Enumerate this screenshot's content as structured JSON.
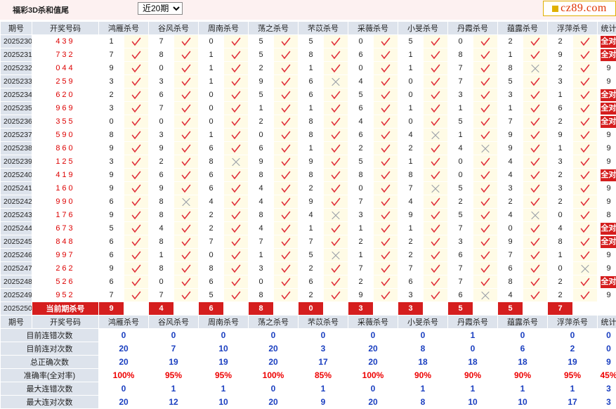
{
  "header": {
    "title": "福彩3D杀和值尾",
    "period_selected": "近20期",
    "period_options": [
      "近20期"
    ],
    "logo_text": "cz89.com"
  },
  "table": {
    "header_period": "期号",
    "header_draw": "开奖号码",
    "header_stat": "统计",
    "experts": [
      "鸿雁杀号",
      "谷风杀号",
      "周南杀号",
      "荡之杀号",
      "芣苡杀号",
      "采薇杀号",
      "小旻杀号",
      "丹霞杀号",
      "蕴露杀号",
      "浮萍杀号"
    ],
    "all_correct_label": "全对",
    "rows": [
      {
        "period": "2025230",
        "draw": "439",
        "kills": [
          "1",
          "7",
          "0",
          "5",
          "5",
          "0",
          "5",
          "0",
          "2",
          "2"
        ],
        "results": [
          1,
          1,
          1,
          1,
          1,
          1,
          1,
          1,
          1,
          1
        ],
        "stat": "全对"
      },
      {
        "period": "2025231",
        "draw": "732",
        "kills": [
          "7",
          "8",
          "1",
          "5",
          "8",
          "6",
          "1",
          "8",
          "1",
          "9"
        ],
        "results": [
          1,
          1,
          1,
          1,
          1,
          1,
          1,
          1,
          1,
          1
        ],
        "stat": "全对"
      },
      {
        "period": "2025232",
        "draw": "044",
        "kills": [
          "9",
          "0",
          "1",
          "2",
          "1",
          "0",
          "1",
          "7",
          "8",
          "2"
        ],
        "results": [
          1,
          1,
          1,
          1,
          1,
          1,
          1,
          1,
          0,
          1
        ],
        "stat": "9"
      },
      {
        "period": "2025233",
        "draw": "259",
        "kills": [
          "3",
          "3",
          "1",
          "9",
          "6",
          "4",
          "0",
          "7",
          "5",
          "3"
        ],
        "results": [
          1,
          1,
          1,
          1,
          0,
          1,
          1,
          1,
          1,
          1
        ],
        "stat": "9"
      },
      {
        "period": "2025234",
        "draw": "620",
        "kills": [
          "2",
          "6",
          "0",
          "5",
          "6",
          "5",
          "0",
          "3",
          "3",
          "1"
        ],
        "results": [
          1,
          1,
          1,
          1,
          1,
          1,
          1,
          1,
          1,
          1
        ],
        "stat": "全对"
      },
      {
        "period": "2025235",
        "draw": "969",
        "kills": [
          "3",
          "7",
          "0",
          "1",
          "1",
          "6",
          "1",
          "1",
          "1",
          "6"
        ],
        "results": [
          1,
          1,
          1,
          1,
          1,
          1,
          1,
          1,
          1,
          1
        ],
        "stat": "全对"
      },
      {
        "period": "2025236",
        "draw": "355",
        "kills": [
          "0",
          "0",
          "0",
          "2",
          "8",
          "4",
          "0",
          "5",
          "7",
          "2"
        ],
        "results": [
          1,
          1,
          1,
          1,
          1,
          1,
          1,
          1,
          1,
          1
        ],
        "stat": "全对"
      },
      {
        "period": "2025237",
        "draw": "590",
        "kills": [
          "8",
          "3",
          "1",
          "0",
          "8",
          "6",
          "4",
          "1",
          "9",
          "9"
        ],
        "results": [
          1,
          1,
          1,
          1,
          1,
          1,
          0,
          1,
          1,
          1
        ],
        "stat": "9"
      },
      {
        "period": "2025238",
        "draw": "860",
        "kills": [
          "9",
          "9",
          "6",
          "6",
          "1",
          "2",
          "2",
          "4",
          "9",
          "1"
        ],
        "results": [
          1,
          1,
          1,
          1,
          1,
          1,
          1,
          0,
          1,
          1
        ],
        "stat": "9"
      },
      {
        "period": "2025239",
        "draw": "125",
        "kills": [
          "3",
          "2",
          "8",
          "9",
          "9",
          "5",
          "1",
          "0",
          "4",
          "3"
        ],
        "results": [
          1,
          1,
          0,
          1,
          1,
          1,
          1,
          1,
          1,
          1
        ],
        "stat": "9"
      },
      {
        "period": "2025240",
        "draw": "419",
        "kills": [
          "9",
          "6",
          "6",
          "8",
          "8",
          "8",
          "8",
          "0",
          "4",
          "2"
        ],
        "results": [
          1,
          1,
          1,
          1,
          1,
          1,
          1,
          1,
          1,
          1
        ],
        "stat": "全对"
      },
      {
        "period": "2025241",
        "draw": "160",
        "kills": [
          "9",
          "9",
          "6",
          "4",
          "2",
          "0",
          "7",
          "5",
          "3",
          "3"
        ],
        "results": [
          1,
          1,
          1,
          1,
          1,
          1,
          0,
          1,
          1,
          1
        ],
        "stat": "9"
      },
      {
        "period": "2025242",
        "draw": "990",
        "kills": [
          "6",
          "8",
          "4",
          "4",
          "9",
          "7",
          "4",
          "2",
          "2",
          "2"
        ],
        "results": [
          1,
          0,
          1,
          1,
          1,
          1,
          1,
          1,
          1,
          1
        ],
        "stat": "9"
      },
      {
        "period": "2025243",
        "draw": "176",
        "kills": [
          "9",
          "8",
          "2",
          "8",
          "4",
          "3",
          "9",
          "5",
          "4",
          "0"
        ],
        "results": [
          1,
          1,
          1,
          1,
          0,
          1,
          1,
          1,
          0,
          1
        ],
        "stat": "8"
      },
      {
        "period": "2025244",
        "draw": "673",
        "kills": [
          "5",
          "4",
          "2",
          "4",
          "1",
          "1",
          "1",
          "7",
          "0",
          "4"
        ],
        "results": [
          1,
          1,
          1,
          1,
          1,
          1,
          1,
          1,
          1,
          1
        ],
        "stat": "全对"
      },
      {
        "period": "2025245",
        "draw": "848",
        "kills": [
          "6",
          "8",
          "7",
          "7",
          "7",
          "2",
          "2",
          "3",
          "9",
          "8"
        ],
        "results": [
          1,
          1,
          1,
          1,
          1,
          1,
          1,
          1,
          1,
          1
        ],
        "stat": "全对"
      },
      {
        "period": "2025246",
        "draw": "997",
        "kills": [
          "6",
          "1",
          "0",
          "1",
          "5",
          "1",
          "2",
          "6",
          "7",
          "1"
        ],
        "results": [
          1,
          1,
          1,
          1,
          0,
          1,
          1,
          1,
          1,
          1
        ],
        "stat": "9"
      },
      {
        "period": "2025247",
        "draw": "262",
        "kills": [
          "9",
          "8",
          "8",
          "3",
          "2",
          "7",
          "7",
          "7",
          "6",
          "0"
        ],
        "results": [
          1,
          1,
          1,
          1,
          1,
          1,
          1,
          1,
          1,
          0
        ],
        "stat": "9"
      },
      {
        "period": "2025248",
        "draw": "526",
        "kills": [
          "6",
          "0",
          "6",
          "0",
          "6",
          "2",
          "6",
          "7",
          "8",
          "2"
        ],
        "results": [
          1,
          1,
          1,
          1,
          1,
          1,
          1,
          1,
          1,
          1
        ],
        "stat": "全对"
      },
      {
        "period": "2025249",
        "draw": "952",
        "kills": [
          "7",
          "7",
          "5",
          "8",
          "2",
          "9",
          "3",
          "6",
          "4",
          "2"
        ],
        "results": [
          1,
          1,
          1,
          1,
          1,
          1,
          1,
          0,
          1,
          1
        ],
        "stat": "9"
      }
    ],
    "current": {
      "period": "2025250",
      "label": "当前期杀号",
      "kills": [
        "9",
        "4",
        "6",
        "8",
        "0",
        "3",
        "3",
        "5",
        "5",
        "7"
      ]
    },
    "summary_header": {
      "period": "期号",
      "draw": "开奖号码",
      "stat": "统计"
    },
    "summary": [
      {
        "label": "目前连错次数",
        "values": [
          "0",
          "0",
          "0",
          "0",
          "0",
          "0",
          "0",
          "1",
          "0",
          "0"
        ],
        "stat": "0"
      },
      {
        "label": "目前连对次数",
        "values": [
          "20",
          "7",
          "10",
          "20",
          "3",
          "20",
          "8",
          "0",
          "6",
          "2"
        ],
        "stat": "0"
      },
      {
        "label": "总正确次数",
        "values": [
          "20",
          "19",
          "19",
          "20",
          "17",
          "20",
          "18",
          "18",
          "18",
          "19"
        ],
        "stat": "9"
      },
      {
        "label": "准确率(全对率)",
        "values": [
          "100%",
          "95%",
          "95%",
          "100%",
          "85%",
          "100%",
          "90%",
          "90%",
          "90%",
          "95%"
        ],
        "stat": "45%"
      },
      {
        "label": "最大连错次数",
        "values": [
          "0",
          "1",
          "1",
          "0",
          "1",
          "0",
          "1",
          "1",
          "1",
          "1"
        ],
        "stat": "3"
      },
      {
        "label": "最大连对次数",
        "values": [
          "20",
          "12",
          "10",
          "20",
          "9",
          "20",
          "8",
          "10",
          "10",
          "17"
        ],
        "stat": "3"
      }
    ]
  }
}
